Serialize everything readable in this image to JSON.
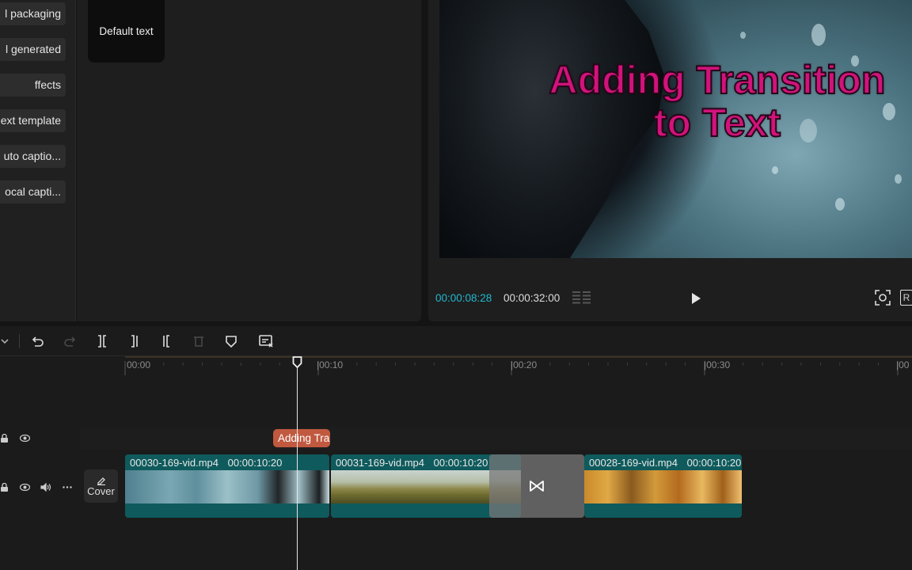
{
  "sidebar": {
    "items": [
      {
        "label": "l packaging"
      },
      {
        "label": "l generated"
      },
      {
        "label": "ffects"
      },
      {
        "label": "ext template"
      },
      {
        "label": "uto captio..."
      },
      {
        "label": "ocal capti..."
      }
    ]
  },
  "library": {
    "default_text_card": "Default text"
  },
  "player": {
    "overlay_text_line1": "Adding Transition",
    "overlay_text_line2": "to Text",
    "current_time": "00:00:08:28",
    "total_time": "00:00:32:00",
    "ratio_label": "R"
  },
  "timeline": {
    "ruler": [
      "00:00",
      "|00:10",
      "|00:20",
      "|00:30",
      "|00"
    ],
    "text_clip_label": "Adding Tra",
    "cover_label": "Cover",
    "transition_icon": "bowtie-icon",
    "clips": [
      {
        "name": "00030-169-vid.mp4",
        "duration": "00:00:10:20"
      },
      {
        "name": "00031-169-vid.mp4",
        "duration": "00:00:10:20"
      },
      {
        "name": "00028-169-vid.mp4",
        "duration": "00:00:10:20"
      }
    ]
  },
  "colors": {
    "accent_time": "#22b8cf",
    "text_clip": "#c0593f",
    "video_clip": "#0f5a5c",
    "overlay_title": "#d1137c"
  }
}
